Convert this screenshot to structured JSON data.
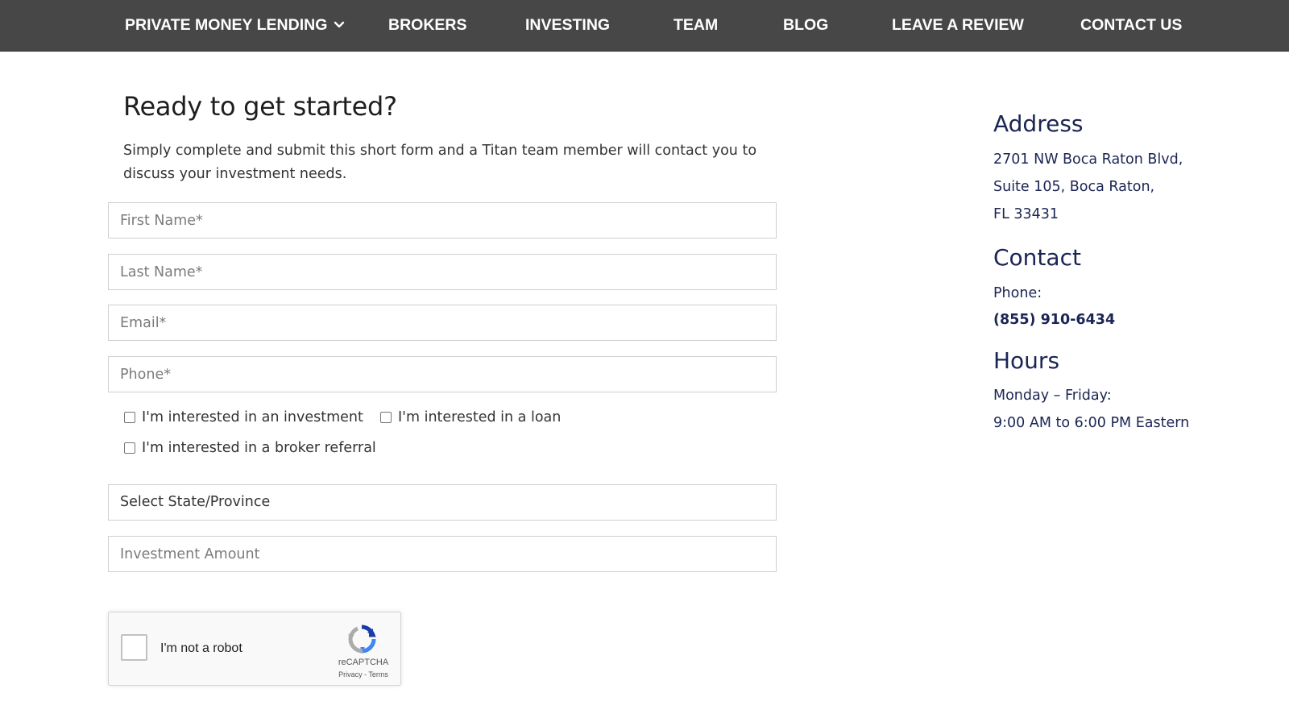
{
  "nav": {
    "items": [
      {
        "label": "PRIVATE MONEY LENDING"
      },
      {
        "label": "BROKERS"
      },
      {
        "label": "INVESTING"
      },
      {
        "label": "TEAM"
      },
      {
        "label": "BLOG"
      },
      {
        "label": "LEAVE A REVIEW"
      },
      {
        "label": "CONTACT US"
      }
    ]
  },
  "form": {
    "title": "Ready to get started?",
    "intro": "Simply complete and submit this short form and a Titan team member will contact you to discuss your investment needs.",
    "first_name_placeholder": "First Name*",
    "last_name_placeholder": "Last Name*",
    "email_placeholder": "Email*",
    "phone_placeholder": "Phone*",
    "checkboxes": [
      {
        "label": "I'm interested in an investment"
      },
      {
        "label": "I'm interested in a loan"
      },
      {
        "label": "I'm interested in a broker referral"
      }
    ],
    "state_select": "Select State/Province",
    "amount_placeholder": "Investment Amount"
  },
  "recaptcha": {
    "label": "I'm not a robot",
    "brand": "reCAPTCHA",
    "terms": "Privacy - Terms"
  },
  "sidebar": {
    "address_heading": "Address",
    "address_lines": [
      "2701 NW Boca Raton Blvd,",
      "Suite 105, Boca Raton,",
      "FL 33431"
    ],
    "contact_heading": "Contact",
    "phone_label": "Phone:",
    "phone_number": "(855) 910-6434",
    "hours_heading": "Hours",
    "hours_days": "Monday – Friday:",
    "hours_time": "9:00 AM to 6:00 PM Eastern"
  },
  "colors": {
    "nav_bg": "#474747",
    "nav_text": "#ffffff",
    "sidebar_text": "#1b2553"
  }
}
